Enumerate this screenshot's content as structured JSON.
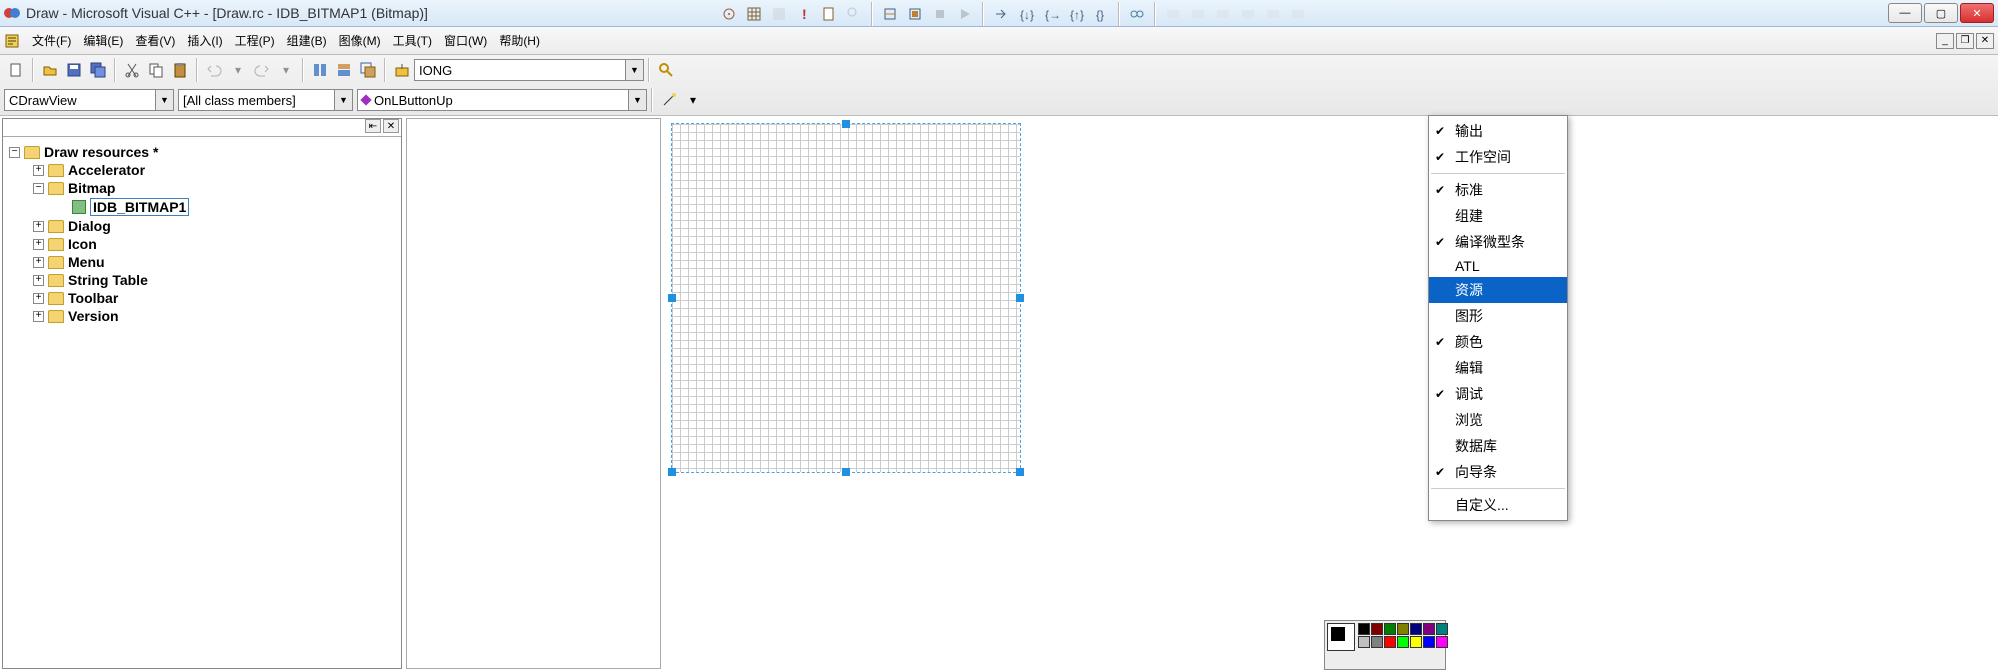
{
  "title": "Draw - Microsoft Visual C++ - [Draw.rc - IDB_BITMAP1 (Bitmap)]",
  "menu": {
    "file": "文件(F)",
    "edit": "编辑(E)",
    "view": "查看(V)",
    "insert": "插入(I)",
    "project": "工程(P)",
    "build": "组建(B)",
    "image": "图像(M)",
    "tools": "工具(T)",
    "window": "窗口(W)",
    "help": "帮助(H)"
  },
  "combos": {
    "visual": "IONG",
    "class": "CDrawView",
    "members": "[All class members]",
    "func": "OnLButtonUp"
  },
  "tree": {
    "root": "Draw resources *",
    "accelerator": "Accelerator",
    "bitmap": "Bitmap",
    "idb1": "IDB_BITMAP1",
    "dialog": "Dialog",
    "icon": "Icon",
    "menu": "Menu",
    "stringtable": "String Table",
    "toolbar": "Toolbar",
    "version": "Version"
  },
  "context_menu": {
    "output": "输出",
    "workspace": "工作空间",
    "standard": "标准",
    "build": "组建",
    "minibar": "编译微型条",
    "atl": "ATL",
    "resource": "资源",
    "graphics": "图形",
    "color": "颜色",
    "edit": "编辑",
    "debug": "调试",
    "browse": "浏览",
    "database": "数据库",
    "wizard": "向导条",
    "custom": "自定义..."
  },
  "palette_colors": [
    "#000000",
    "#800000",
    "#008000",
    "#808000",
    "#000080",
    "#800080",
    "#008080",
    "#c0c0c0",
    "#808080",
    "#ff0000",
    "#00ff00",
    "#ffff00",
    "#0000ff",
    "#ff00ff"
  ]
}
